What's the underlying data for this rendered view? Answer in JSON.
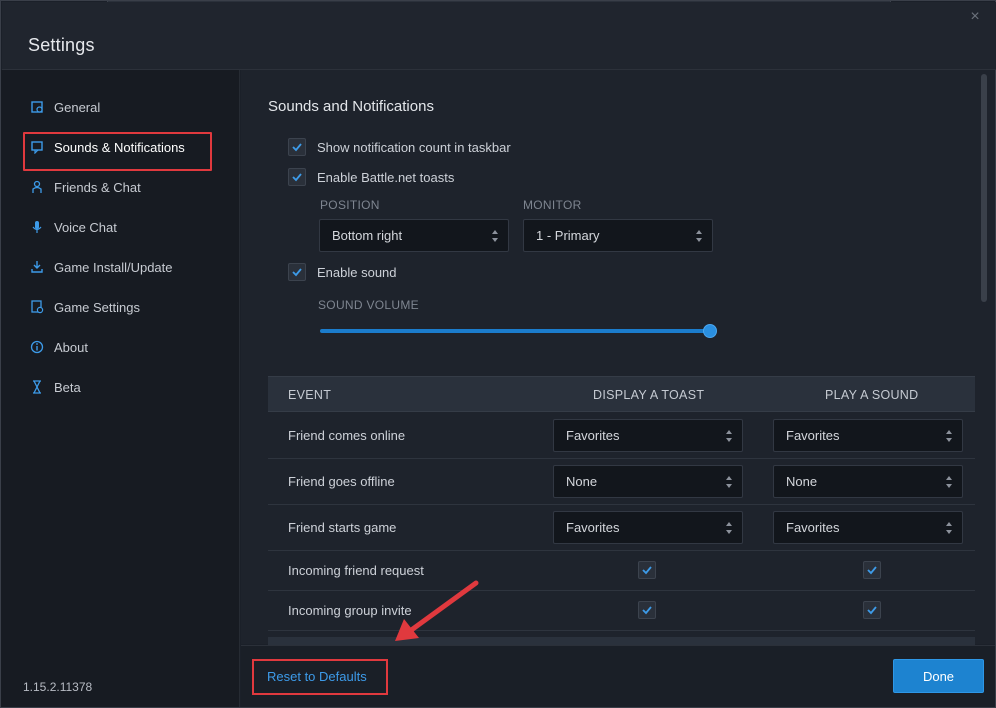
{
  "window": {
    "title": "Settings",
    "close_glyph": "×"
  },
  "sidebar": {
    "items": [
      {
        "label": "General",
        "icon": "gear-icon"
      },
      {
        "label": "Sounds & Notifications",
        "icon": "notification-icon"
      },
      {
        "label": "Friends & Chat",
        "icon": "friends-icon"
      },
      {
        "label": "Voice Chat",
        "icon": "microphone-icon"
      },
      {
        "label": "Game Install/Update",
        "icon": "download-icon"
      },
      {
        "label": "Game Settings",
        "icon": "game-settings-icon"
      },
      {
        "label": "About",
        "icon": "info-icon"
      },
      {
        "label": "Beta",
        "icon": "beta-icon"
      }
    ],
    "active": "Sounds & Notifications",
    "version": "1.15.2.11378"
  },
  "content": {
    "section_title": "Sounds and Notifications",
    "show_count": {
      "label": "Show notification count in taskbar",
      "checked": true
    },
    "enable_toasts": {
      "label": "Enable Battle.net toasts",
      "checked": true
    },
    "position": {
      "label": "POSITION",
      "value": "Bottom right"
    },
    "monitor": {
      "label": "MONITOR",
      "value": "1 - Primary"
    },
    "enable_sound": {
      "label": "Enable sound",
      "checked": true
    },
    "sound_volume": {
      "label": "SOUND VOLUME",
      "value": 1.0
    }
  },
  "table": {
    "headers": {
      "event": "EVENT",
      "toast": "DISPLAY A TOAST",
      "sound": "PLAY A SOUND"
    },
    "rows": [
      {
        "event": "Friend comes online",
        "toast": "Favorites",
        "sound": "Favorites"
      },
      {
        "event": "Friend goes offline",
        "toast": "None",
        "sound": "None"
      },
      {
        "event": "Friend starts game",
        "toast": "Favorites",
        "sound": "Favorites"
      },
      {
        "event": "Incoming friend request",
        "toast_checked": true,
        "sound_checked": true
      },
      {
        "event": "Incoming group invite",
        "toast_checked": true,
        "sound_checked": true
      }
    ]
  },
  "footer": {
    "reset_label": "Reset to Defaults",
    "done_label": "Done"
  },
  "colors": {
    "accent": "#1d83d0",
    "highlight": "#e0393e"
  }
}
